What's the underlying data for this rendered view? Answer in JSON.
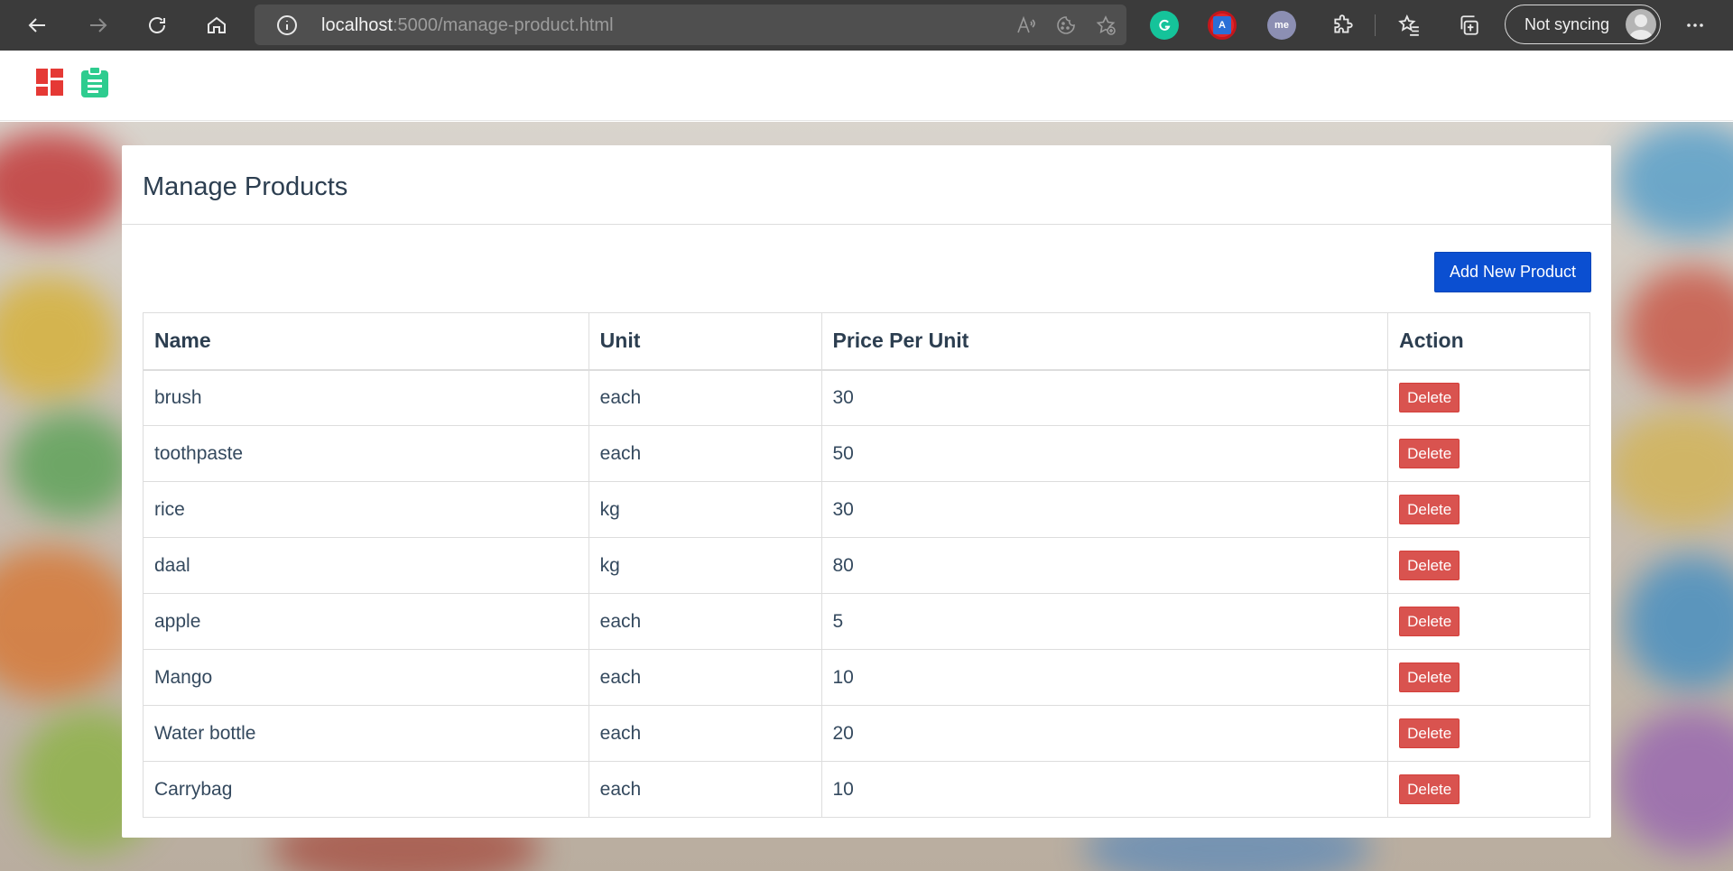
{
  "browser": {
    "url_host": "localhost",
    "url_rest": ":5000/manage-product.html",
    "sync_label": "Not syncing",
    "icons": {
      "back": "back-arrow-icon",
      "forward": "forward-arrow-icon",
      "reload": "reload-icon",
      "home": "home-icon",
      "info": "info-icon",
      "read_aloud": "read-aloud-icon",
      "cookie": "cookie-icon",
      "add_favorite": "add-favorite-icon",
      "grammarly": "grammarly-icon",
      "translate": "translate-icon",
      "extension_me": "me-extension-icon",
      "extensions": "extensions-icon",
      "favorites": "favorites-icon",
      "collections": "collections-icon",
      "more": "more-icon"
    }
  },
  "header": {
    "icons": {
      "dashboard": "dashboard-icon",
      "clipboard": "clipboard-icon"
    },
    "colors": {
      "dashboard": "#e53935",
      "clipboard": "#2ecc8f"
    }
  },
  "panel": {
    "title": "Manage Products",
    "add_button_label": "Add New Product"
  },
  "table": {
    "headers": [
      "Name",
      "Unit",
      "Price Per Unit",
      "Action"
    ],
    "rows": [
      {
        "name": "brush",
        "unit": "each",
        "price": "30",
        "action": "Delete"
      },
      {
        "name": "toothpaste",
        "unit": "each",
        "price": "50",
        "action": "Delete"
      },
      {
        "name": "rice",
        "unit": "kg",
        "price": "30",
        "action": "Delete"
      },
      {
        "name": "daal",
        "unit": "kg",
        "price": "80",
        "action": "Delete"
      },
      {
        "name": "apple",
        "unit": "each",
        "price": "5",
        "action": "Delete"
      },
      {
        "name": "Mango",
        "unit": "each",
        "price": "10",
        "action": "Delete"
      },
      {
        "name": "Water bottle",
        "unit": "each",
        "price": "20",
        "action": "Delete"
      },
      {
        "name": "Carrybag",
        "unit": "each",
        "price": "10",
        "action": "Delete"
      }
    ]
  },
  "colors": {
    "primary_button": "#0b4fd1",
    "delete_button": "#d9534f",
    "text": "#34495e"
  }
}
